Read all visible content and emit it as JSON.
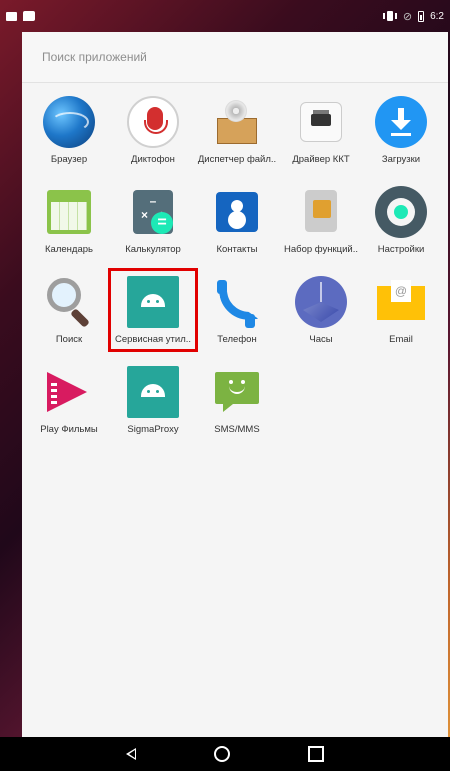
{
  "status": {
    "time": "6:2"
  },
  "search": {
    "placeholder": "Поиск приложений"
  },
  "apps": [
    {
      "label": "Браузер",
      "icon": "browser-globe-icon"
    },
    {
      "label": "Диктофон",
      "icon": "microphone-icon"
    },
    {
      "label": "Диспетчер файл..",
      "icon": "file-manager-box-icon"
    },
    {
      "label": "Драйвер ККТ",
      "icon": "receipt-printer-icon"
    },
    {
      "label": "Загрузки",
      "icon": "download-icon"
    },
    {
      "label": "Календарь",
      "icon": "calendar-icon"
    },
    {
      "label": "Калькулятор",
      "icon": "calculator-icon"
    },
    {
      "label": "Контакты",
      "icon": "contacts-icon"
    },
    {
      "label": "Набор функций..",
      "icon": "sim-toolkit-icon"
    },
    {
      "label": "Настройки",
      "icon": "settings-gear-icon"
    },
    {
      "label": "Поиск",
      "icon": "magnifier-icon"
    },
    {
      "label": "Сервисная утил..",
      "icon": "android-icon"
    },
    {
      "label": "Телефон",
      "icon": "phone-icon"
    },
    {
      "label": "Часы",
      "icon": "clock-icon"
    },
    {
      "label": "Email",
      "icon": "email-icon"
    },
    {
      "label": "Play Фильмы",
      "icon": "play-movies-icon"
    },
    {
      "label": "SigmaProxy",
      "icon": "android-icon"
    },
    {
      "label": "SMS/MMS",
      "icon": "sms-icon"
    }
  ],
  "highlight_color": "#e10000"
}
